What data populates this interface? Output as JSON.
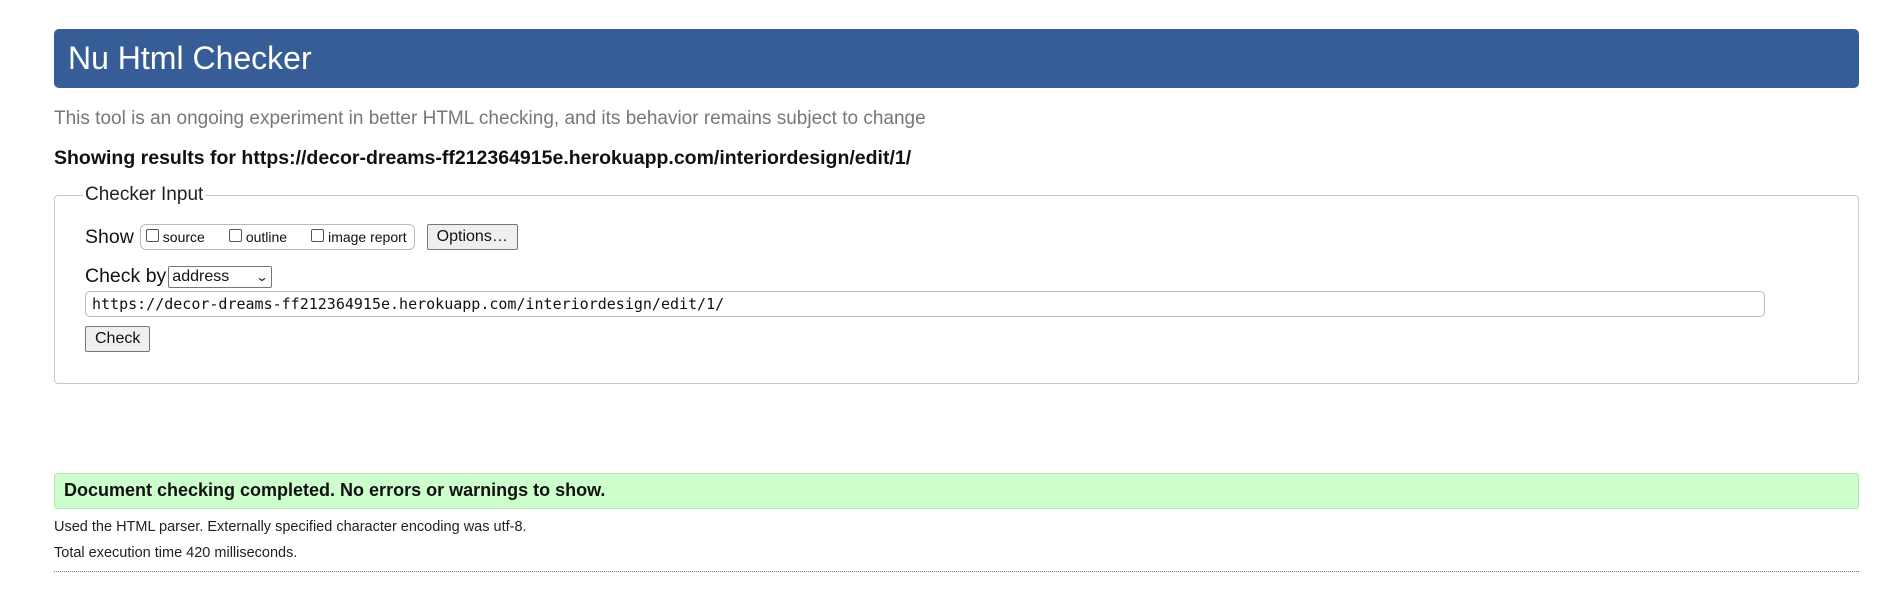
{
  "header": {
    "title": "Nu Html Checker"
  },
  "subtitle": "This tool is an ongoing experiment in better HTML checking, and its behavior remains subject to change",
  "showing": "Showing results for https://decor-dreams-ff212364915e.herokuapp.com/interiordesign/edit/1/",
  "checker": {
    "legend": "Checker Input",
    "show_label": "Show",
    "show_options": [
      {
        "label": "source",
        "checked": false
      },
      {
        "label": "outline",
        "checked": false
      },
      {
        "label": "image report",
        "checked": false
      }
    ],
    "options_button": "Options…",
    "check_by_label": "Check by",
    "check_by_value": "address",
    "url_value": "https://decor-dreams-ff212364915e.herokuapp.com/interiordesign/edit/1/",
    "check_button": "Check"
  },
  "result": {
    "message": "Document checking completed. No errors or warnings to show.",
    "parser_note": "Used the HTML parser. Externally specified character encoding was utf-8.",
    "execution_time": "Total execution time 420 milliseconds."
  },
  "colors": {
    "banner": "#365d95",
    "success": "#ccffcc"
  }
}
